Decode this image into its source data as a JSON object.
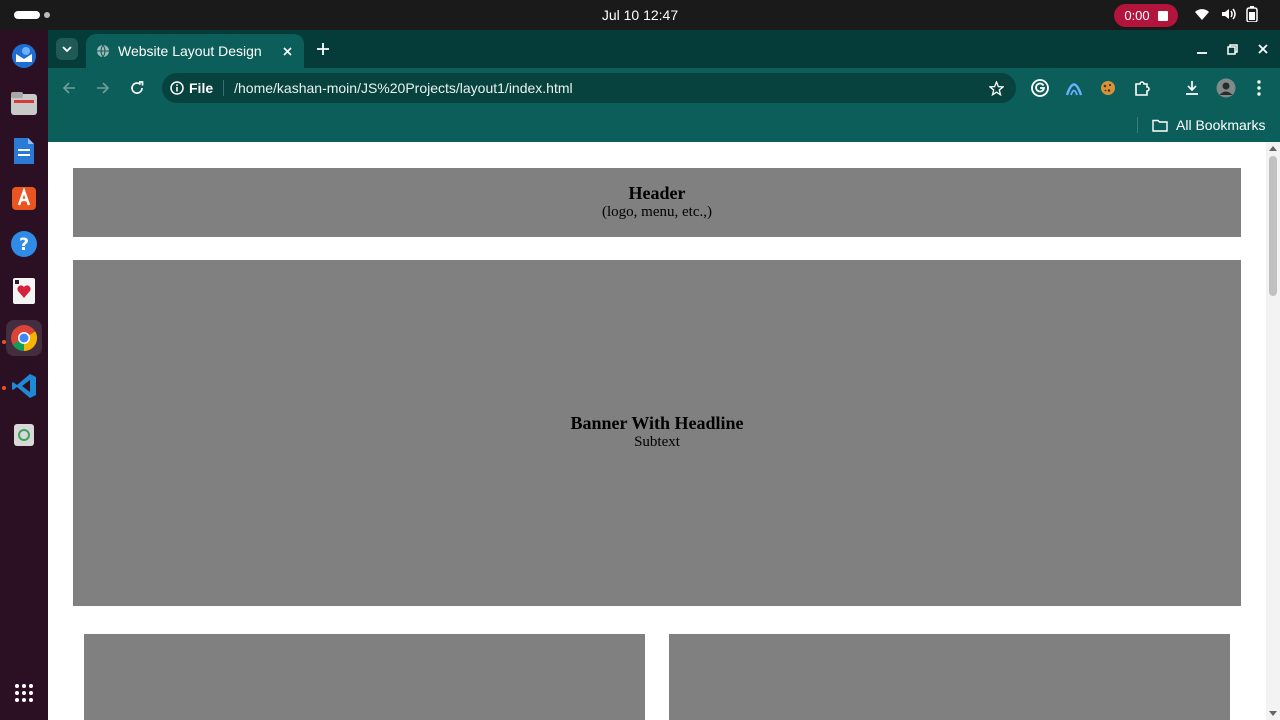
{
  "system": {
    "clock": "Jul 10  12:47",
    "recording_time": "0:00"
  },
  "dock": {
    "apps": [
      "thunderbird-icon",
      "files-icon",
      "writer-icon",
      "app-center-icon",
      "help-icon",
      "solitaire-icon",
      "chrome-icon",
      "vscode-icon",
      "trash-icon"
    ],
    "show_apps": "apps-grid-icon"
  },
  "browser": {
    "tab_title": "Website Layout Design",
    "omnibox": {
      "scheme_label": "File",
      "url": "/home/kashan-moin/JS%20Projects/layout1/index.html"
    },
    "bookmarks": {
      "all_label": "All Bookmarks"
    }
  },
  "page": {
    "header": {
      "title": "Header",
      "subtitle": "(logo, menu, etc.,)"
    },
    "banner": {
      "headline": "Banner With Headline",
      "subtext": "Subtext"
    }
  },
  "colors": {
    "tab_strip": "#053c3a",
    "toolbar": "#0b5e5a",
    "placeholder_gray": "#808080",
    "recording": "#b3143c"
  }
}
